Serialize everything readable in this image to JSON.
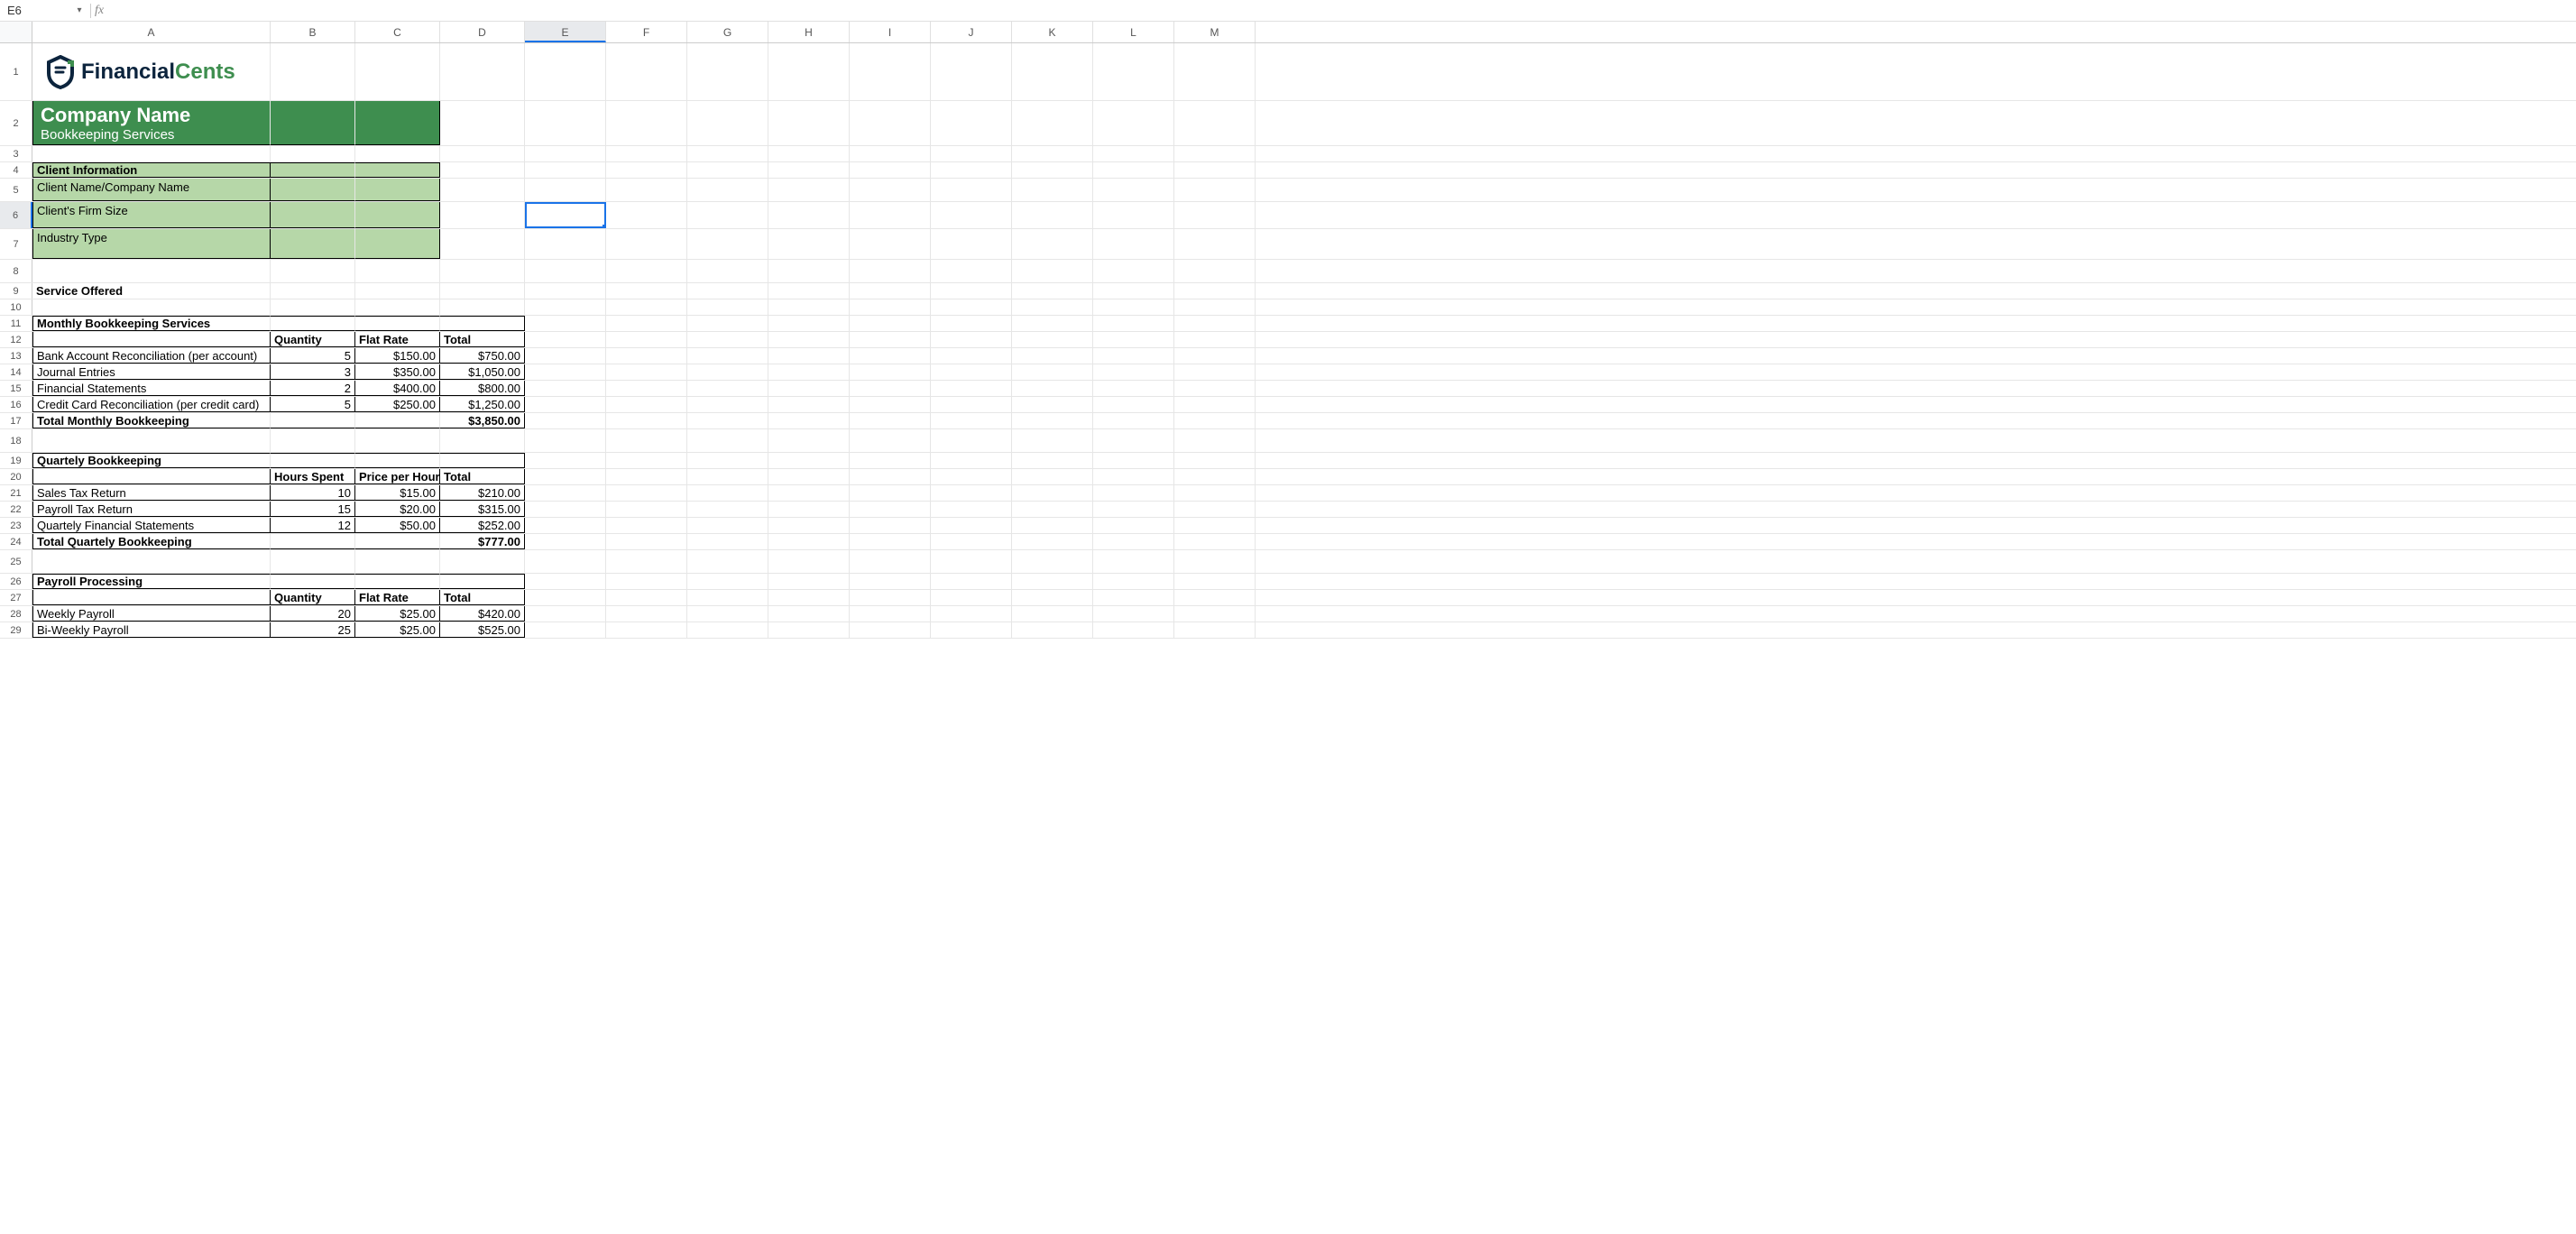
{
  "namebox": "E6",
  "fx": "fx",
  "formula": "",
  "cols": [
    "A",
    "B",
    "C",
    "D",
    "E",
    "F",
    "G",
    "H",
    "I",
    "J",
    "K",
    "L",
    "M"
  ],
  "active_col": "E",
  "active_row": "6",
  "logo": {
    "word1": "Financial",
    "word2": "Cents"
  },
  "company": {
    "title": "Company Name",
    "subtitle": "Bookkeeping Services"
  },
  "client_header": "Client Information",
  "client_rows": [
    "Client Name/Company Name",
    "Client's Firm Size",
    "Industry Type"
  ],
  "service_offered": "Service Offered",
  "monthly": {
    "title": "Monthly Bookkeeping Services",
    "h_qty": "Quantity",
    "h_rate": "Flat Rate",
    "h_total": "Total",
    "rows": [
      {
        "a": "Bank Account Reconciliation (per account)",
        "q": "5",
        "r": "$150.00",
        "t": "$750.00"
      },
      {
        "a": "Journal Entries",
        "q": "3",
        "r": "$350.00",
        "t": "$1,050.00"
      },
      {
        "a": "Financial Statements",
        "q": "2",
        "r": "$400.00",
        "t": "$800.00"
      },
      {
        "a": "Credit Card Reconciliation (per credit card)",
        "q": "5",
        "r": "$250.00",
        "t": "$1,250.00"
      }
    ],
    "total_label": "Total Monthly Bookkeeping",
    "total": "$3,850.00"
  },
  "quarterly": {
    "title": "Quartely Bookkeeping",
    "h_qty": "Hours Spent",
    "h_rate": "Price per Hour",
    "h_total": "Total",
    "rows": [
      {
        "a": "Sales Tax Return",
        "q": "10",
        "r": "$15.00",
        "t": "$210.00"
      },
      {
        "a": "Payroll Tax Return",
        "q": "15",
        "r": "$20.00",
        "t": "$315.00"
      },
      {
        "a": "Quartely Financial Statements",
        "q": "12",
        "r": "$50.00",
        "t": "$252.00"
      }
    ],
    "total_label": "Total Quartely Bookkeeping",
    "total": "$777.00"
  },
  "payroll": {
    "title": "Payroll Processing",
    "h_qty": "Quantity",
    "h_rate": "Flat Rate",
    "h_total": "Total",
    "rows": [
      {
        "a": "Weekly Payroll",
        "q": "20",
        "r": "$25.00",
        "t": "$420.00"
      },
      {
        "a": "Bi-Weekly Payroll",
        "q": "25",
        "r": "$25.00",
        "t": "$525.00"
      }
    ]
  }
}
